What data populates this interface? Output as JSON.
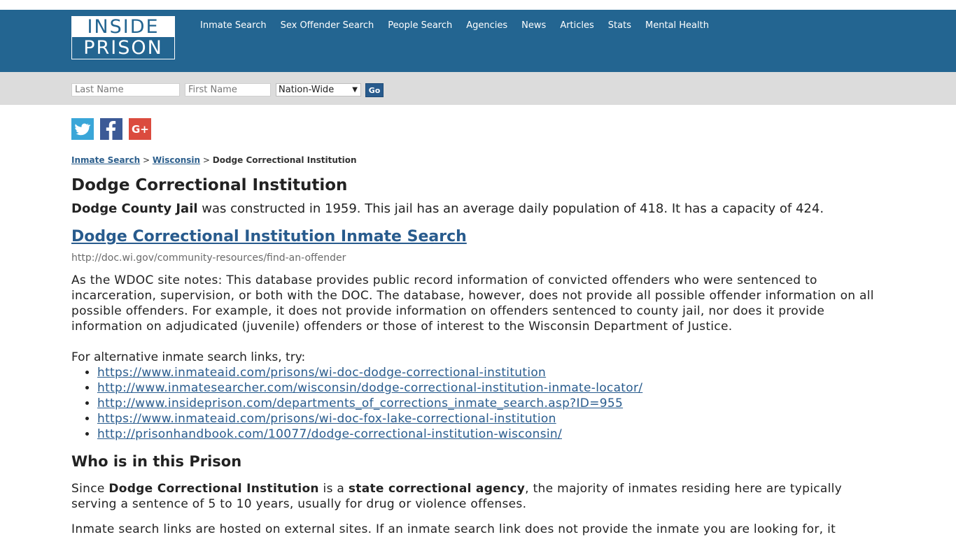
{
  "logo": {
    "top": "INSIDE",
    "bottom": "PRISON"
  },
  "nav": [
    "Inmate Search",
    "Sex Offender Search",
    "People Search",
    "Agencies",
    "News",
    "Articles",
    "Stats",
    "Mental Health"
  ],
  "search": {
    "last_name_placeholder": "Last Name",
    "first_name_placeholder": "First Name",
    "scope_selected": "Nation-Wide",
    "go_label": "Go"
  },
  "social": {
    "twitter": "twitter-icon",
    "facebook": "facebook-icon",
    "google": "google-plus-icon"
  },
  "breadcrumb": {
    "item1": "Inmate Search",
    "sep": ">",
    "item2": "Wisconsin",
    "current": "Dodge Correctional Institution"
  },
  "page": {
    "title": "Dodge Correctional Institution",
    "intro_bold": "Dodge County Jail",
    "intro_rest": " was constructed in 1959. This jail has an average daily population of 418. It has a capacity of 424.",
    "search_link": "Dodge Correctional Institution Inmate Search",
    "search_url": "http://doc.wi.gov/community-resources/find-an-offender",
    "wdoc_note": "As the WDOC site notes: This database provides public record information of convicted offenders who were sentenced to incarceration, supervision, or both with the DOC. The database, however, does not provide all possible offender information on all possible offenders. For example, it does not provide information on offenders sentenced to county jail, nor does it provide information on adjudicated (juvenile) offenders or those of interest to the Wisconsin Department of Justice.",
    "alt_intro": "For alternative inmate search links, try:",
    "alt_links": [
      "https://www.inmateaid.com/prisons/wi-doc-dodge-correctional-institution",
      "http://www.inmatesearcher.com/wisconsin/dodge-correctional-institution-inmate-locator/",
      "http://www.insideprison.com/departments_of_corrections_inmate_search.asp?ID=955",
      "https://www.inmateaid.com/prisons/wi-doc-fox-lake-correctional-institution",
      "http://prisonhandbook.com/10077/dodge-correctional-institution-wisconsin/"
    ],
    "who_heading": "Who is in this Prison",
    "who_p1": "Since ",
    "who_b1": "Dodge Correctional Institution",
    "who_p2": " is a ",
    "who_b2": "state correctional agency",
    "who_p3": ", the majority of inmates residing here are typically serving a sentence of 5 to 10 years, usually for drug or violence offenses.",
    "external_note": "Inmate search links are hosted on external sites. If an inmate search link does not provide the inmate you are looking for, it"
  },
  "colors": {
    "header": "#236591",
    "searchbar": "#dcdcdc",
    "link": "#285b8d"
  }
}
